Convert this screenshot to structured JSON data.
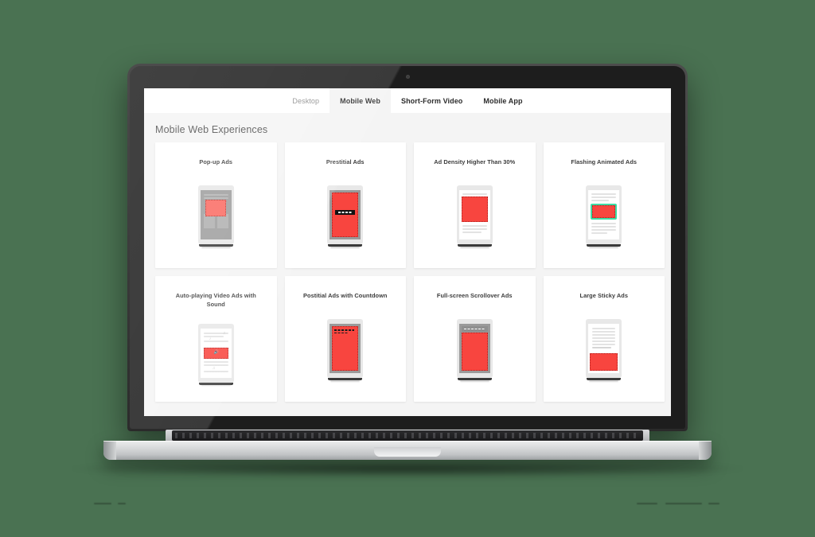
{
  "background_color": "#4a7252",
  "device": {
    "type": "laptop-mockup",
    "camera_icon": "camera-dot"
  },
  "app": {
    "tabs": [
      {
        "label": "Desktop",
        "active": false
      },
      {
        "label": "Mobile Web",
        "active": true
      },
      {
        "label": "Short-Form Video",
        "active": false
      },
      {
        "label": "Mobile App",
        "active": false
      }
    ],
    "page_title": "Mobile Web Experiences",
    "colors": {
      "ad_red": "#f8453f",
      "highlight_green": "#3fdba4",
      "page_background": "#f4f4f4",
      "card_background": "#ffffff",
      "active_tab_background": "#f4f4f4"
    },
    "cards": [
      {
        "title": "Pop-up Ads",
        "mockup": "popup-ad-phone"
      },
      {
        "title": "Prestitial Ads",
        "mockup": "prestitial-ad-phone"
      },
      {
        "title": "Ad Density Higher Than 30%",
        "mockup": "ad-density-phone"
      },
      {
        "title": "Flashing Animated Ads",
        "mockup": "flashing-animated-ad-phone"
      },
      {
        "title": "Auto-playing Video Ads with Sound",
        "mockup": "autoplay-video-ad-phone"
      },
      {
        "title": "Postitial Ads with Countdown",
        "mockup": "postitial-countdown-phone"
      },
      {
        "title": "Full-screen Scrollover Ads",
        "mockup": "scrollover-ad-phone"
      },
      {
        "title": "Large Sticky Ads",
        "mockup": "large-sticky-ad-phone"
      }
    ]
  }
}
